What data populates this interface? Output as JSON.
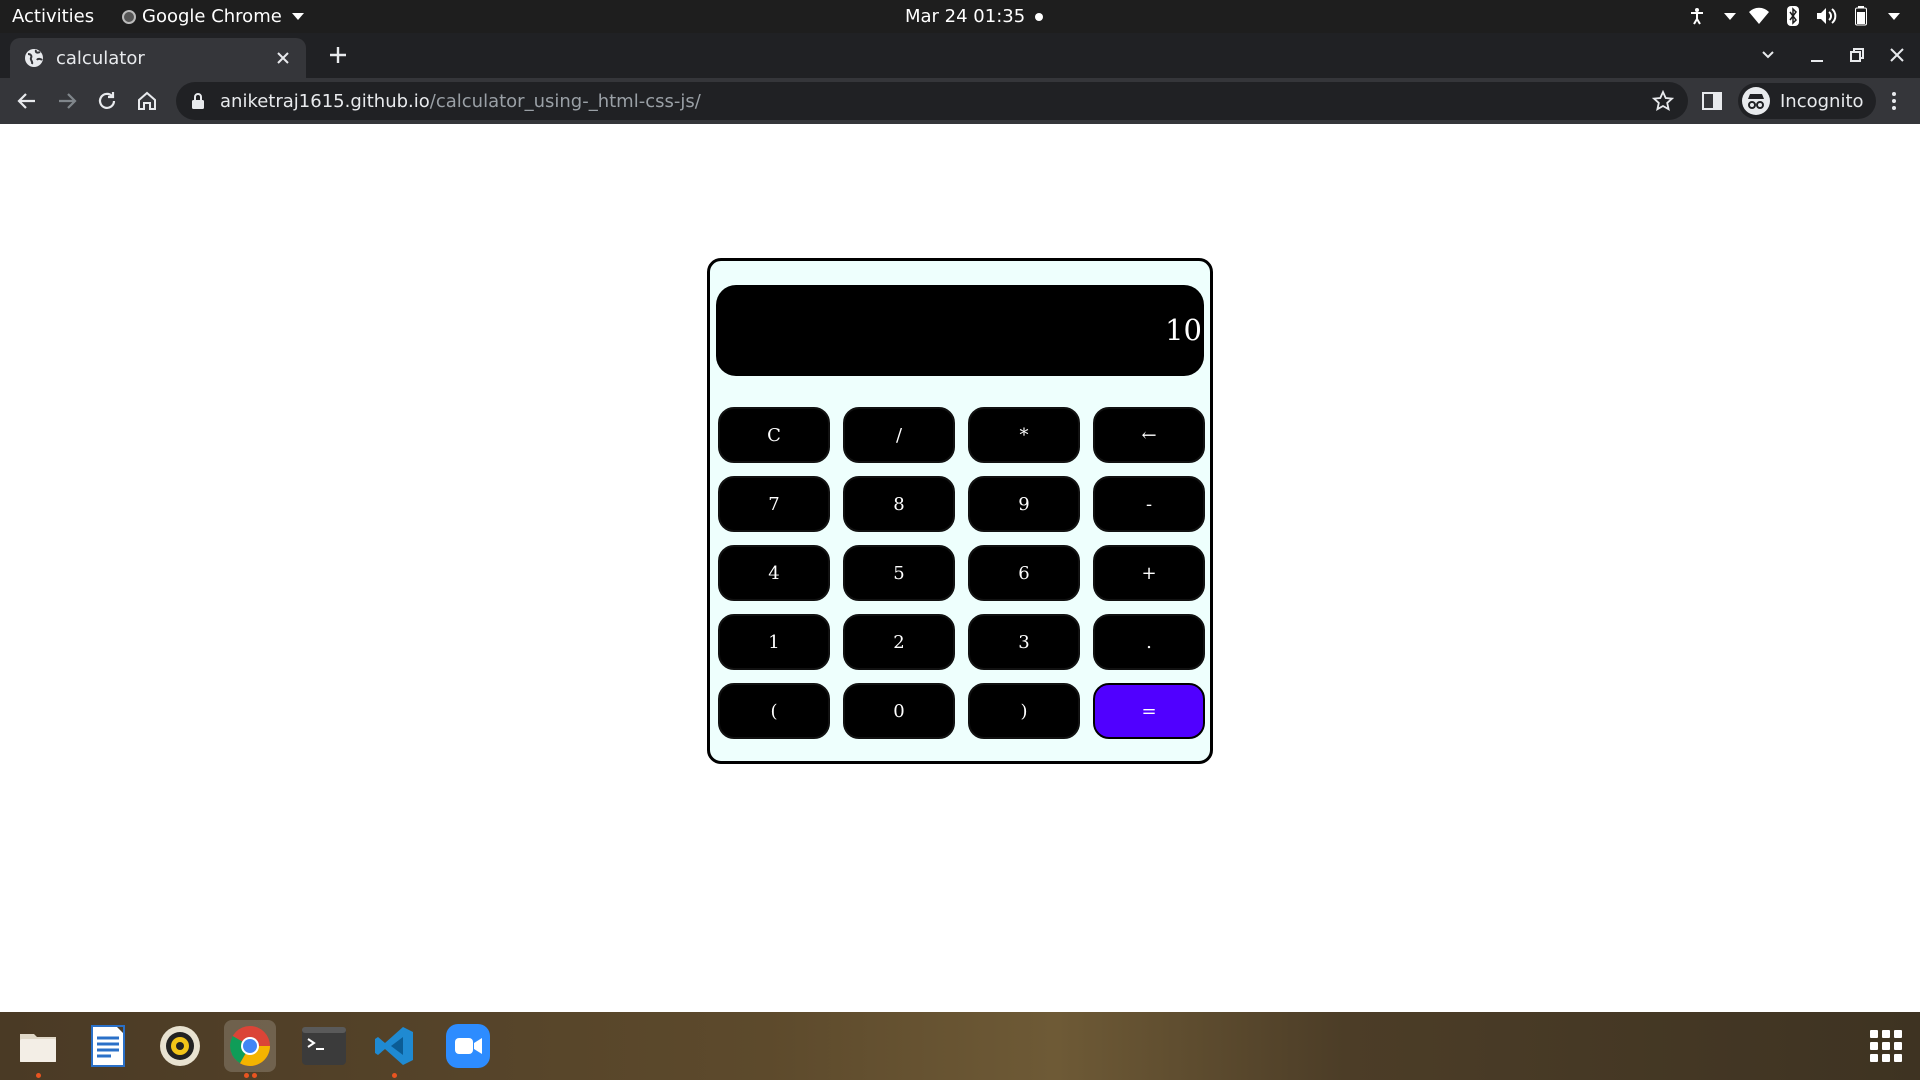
{
  "topbar": {
    "activities": "Activities",
    "app_name": "Google Chrome",
    "clock": "Mar 24  01:35"
  },
  "browser": {
    "tab_title": "calculator",
    "url_host": "aniketraj1615.github.io",
    "url_path": "/calculator_using-_html-css-js/",
    "profile_label": "Incognito"
  },
  "calculator": {
    "display": "10",
    "keys": [
      {
        "label": "C",
        "name": "clear"
      },
      {
        "label": "/",
        "name": "divide"
      },
      {
        "label": "*",
        "name": "multiply"
      },
      {
        "label": "←",
        "name": "backspace"
      },
      {
        "label": "7",
        "name": "7"
      },
      {
        "label": "8",
        "name": "8"
      },
      {
        "label": "9",
        "name": "9"
      },
      {
        "label": "-",
        "name": "minus"
      },
      {
        "label": "4",
        "name": "4"
      },
      {
        "label": "5",
        "name": "5"
      },
      {
        "label": "6",
        "name": "6"
      },
      {
        "label": "+",
        "name": "plus"
      },
      {
        "label": "1",
        "name": "1"
      },
      {
        "label": "2",
        "name": "2"
      },
      {
        "label": "3",
        "name": "3"
      },
      {
        "label": ".",
        "name": "decimal"
      },
      {
        "label": "(",
        "name": "open-paren"
      },
      {
        "label": "0",
        "name": "0"
      },
      {
        "label": ")",
        "name": "close-paren"
      },
      {
        "label": "=",
        "name": "equals"
      }
    ],
    "colors": {
      "equals_key": "#5000ff",
      "key": "#000000",
      "body": "#eefffd"
    }
  },
  "dock": {
    "apps": [
      {
        "name": "files-icon"
      },
      {
        "name": "libreoffice-writer-icon"
      },
      {
        "name": "rhythmbox-icon"
      },
      {
        "name": "chrome-icon"
      },
      {
        "name": "terminal-icon"
      },
      {
        "name": "vscode-icon"
      },
      {
        "name": "zoom-icon"
      }
    ]
  }
}
